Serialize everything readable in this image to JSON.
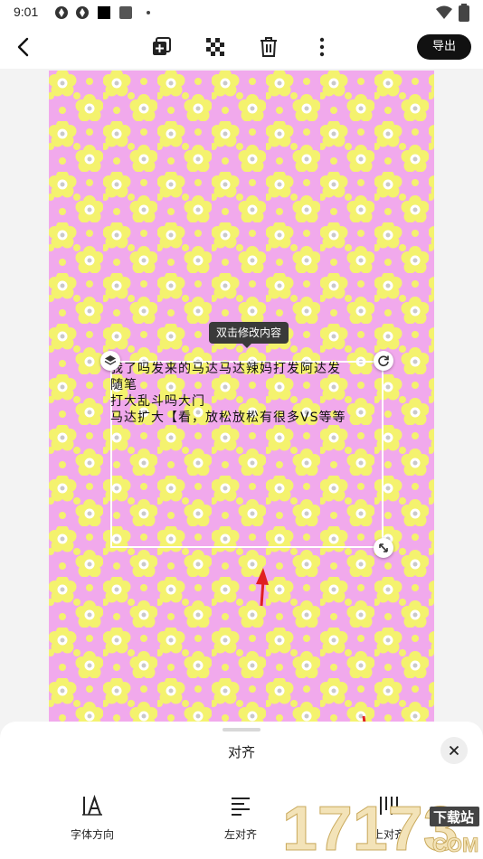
{
  "status_bar": {
    "time": "9:01"
  },
  "toolbar": {
    "export_label": "导出"
  },
  "canvas": {
    "tooltip": "双击修改内容",
    "text_lines": [
      "我了吗发来的马达马达辣妈打发阿达发",
      "随笔",
      "打大乱斗吗大门",
      "马达扩大【看，放松放松有很多VS等等"
    ]
  },
  "sheet": {
    "title": "对齐",
    "options": [
      {
        "label": "字体方向",
        "icon": "text-direction-icon"
      },
      {
        "label": "左对齐",
        "icon": "align-left-icon"
      },
      {
        "label": "上对齐",
        "icon": "align-top-icon"
      }
    ]
  },
  "watermark": {
    "number": "17173",
    "brand": "下载站",
    "domain": "COM"
  },
  "colors": {
    "canvas_bg": "#f1a9ec",
    "flower": "#f4f26e",
    "export_bg": "#111111",
    "annotation_red": "#e02020"
  }
}
